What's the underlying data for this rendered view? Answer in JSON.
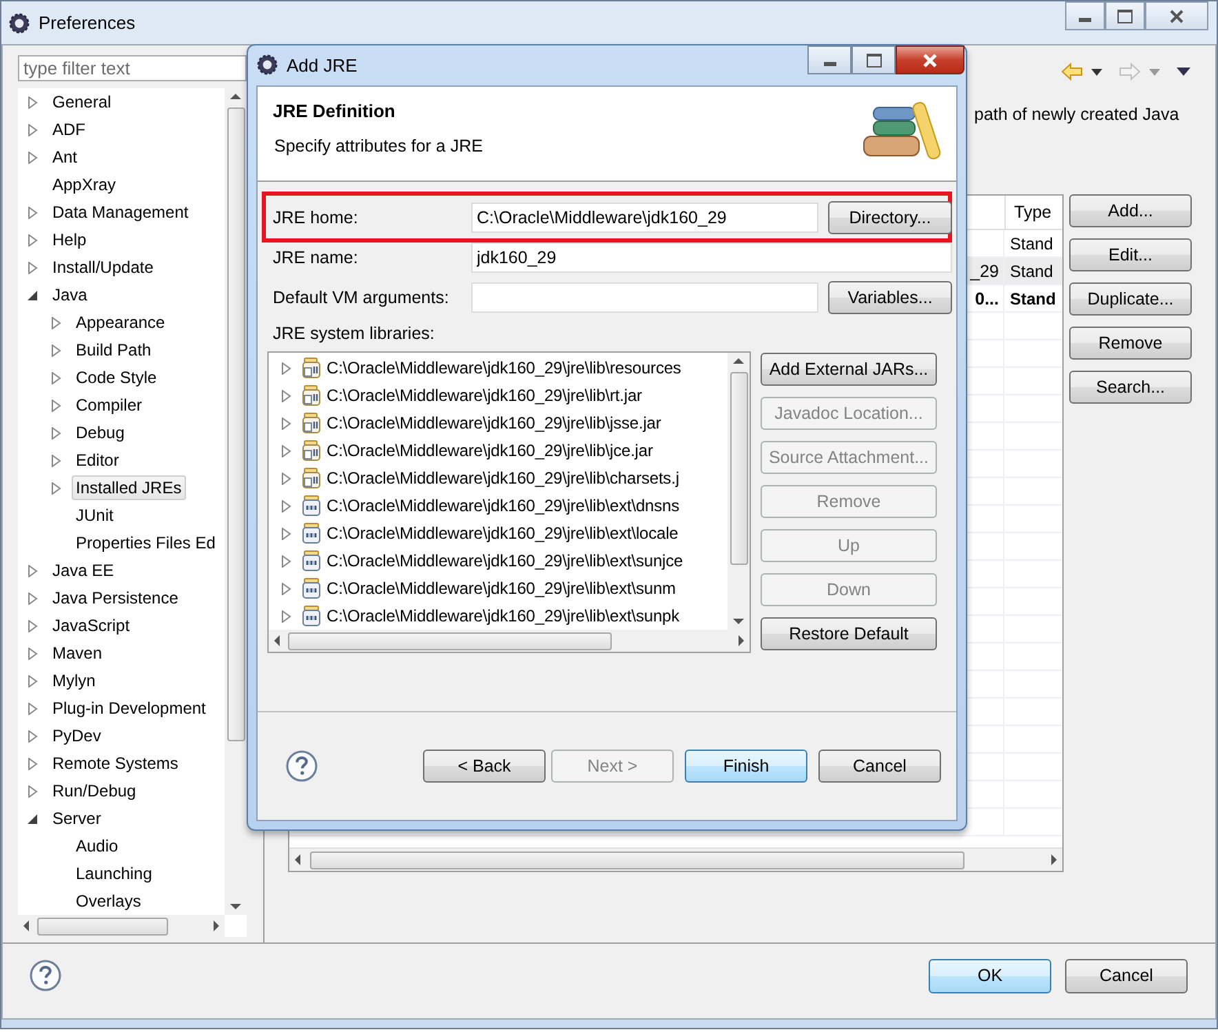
{
  "window": {
    "title": "Preferences"
  },
  "filter": {
    "placeholder": "type filter text"
  },
  "tree": [
    {
      "label": "General",
      "kind": "folder",
      "expanded": false,
      "selected": false
    },
    {
      "label": "ADF",
      "kind": "folder",
      "expanded": false,
      "selected": false
    },
    {
      "label": "Ant",
      "kind": "folder",
      "expanded": false,
      "selected": false
    },
    {
      "label": "AppXray",
      "kind": "leaf",
      "selected": false
    },
    {
      "label": "Data Management",
      "kind": "folder",
      "expanded": false,
      "selected": false
    },
    {
      "label": "Help",
      "kind": "folder",
      "expanded": false,
      "selected": false
    },
    {
      "label": "Install/Update",
      "kind": "folder",
      "expanded": false,
      "selected": false
    },
    {
      "label": "Java",
      "kind": "folder",
      "expanded": true,
      "selected": false,
      "children": [
        {
          "label": "Appearance",
          "kind": "folder",
          "expanded": false,
          "selected": false
        },
        {
          "label": "Build Path",
          "kind": "folder",
          "expanded": false,
          "selected": false
        },
        {
          "label": "Code Style",
          "kind": "folder",
          "expanded": false,
          "selected": false
        },
        {
          "label": "Compiler",
          "kind": "folder",
          "expanded": false,
          "selected": false
        },
        {
          "label": "Debug",
          "kind": "folder",
          "expanded": false,
          "selected": false
        },
        {
          "label": "Editor",
          "kind": "folder",
          "expanded": false,
          "selected": false
        },
        {
          "label": "Installed JREs",
          "kind": "folder",
          "expanded": false,
          "selected": true
        },
        {
          "label": "JUnit",
          "kind": "leaf",
          "selected": false
        },
        {
          "label": "Properties Files Ed",
          "kind": "leaf",
          "selected": false
        }
      ]
    },
    {
      "label": "Java EE",
      "kind": "folder",
      "expanded": false,
      "selected": false
    },
    {
      "label": "Java Persistence",
      "kind": "folder",
      "expanded": false,
      "selected": false
    },
    {
      "label": "JavaScript",
      "kind": "folder",
      "expanded": false,
      "selected": false
    },
    {
      "label": "Maven",
      "kind": "folder",
      "expanded": false,
      "selected": false
    },
    {
      "label": "Mylyn",
      "kind": "folder",
      "expanded": false,
      "selected": false
    },
    {
      "label": "Plug-in Development",
      "kind": "folder",
      "expanded": false,
      "selected": false
    },
    {
      "label": "PyDev",
      "kind": "folder",
      "expanded": false,
      "selected": false
    },
    {
      "label": "Remote Systems",
      "kind": "folder",
      "expanded": false,
      "selected": false
    },
    {
      "label": "Run/Debug",
      "kind": "folder",
      "expanded": false,
      "selected": false
    },
    {
      "label": "Server",
      "kind": "folder",
      "expanded": true,
      "selected": false,
      "children": [
        {
          "label": "Audio",
          "kind": "leaf",
          "selected": false
        },
        {
          "label": "Launching",
          "kind": "leaf",
          "selected": false
        },
        {
          "label": "Overlays",
          "kind": "leaf",
          "selected": false
        }
      ]
    }
  ],
  "page": {
    "description": "path of newly created Java",
    "table": {
      "columns": [
        "Type"
      ],
      "rows": [
        {
          "type": "Stand",
          "selected": false,
          "default": false
        },
        {
          "name": "_29",
          "type": "Stand",
          "selected": true,
          "default": false
        },
        {
          "name": "0...",
          "type": "Stand",
          "selected": false,
          "default": true
        }
      ]
    },
    "buttons": [
      "Add...",
      "Edit...",
      "Duplicate...",
      "Remove",
      "Search..."
    ]
  },
  "footer": {
    "buttons": [
      {
        "label": "OK",
        "default": true
      },
      {
        "label": "Cancel",
        "default": false
      }
    ]
  },
  "dialog": {
    "title": "Add JRE",
    "header": {
      "title": "JRE Definition",
      "subtitle": "Specify attributes for a JRE"
    },
    "fields": [
      {
        "label": "JRE home:",
        "value": "C:\\Oracle\\Middleware\\jdk160_29",
        "button": "Directory...",
        "highlighted": true
      },
      {
        "label": "JRE name:",
        "value": "jdk160_29",
        "highlighted": false
      },
      {
        "label": "Default VM arguments:",
        "button": "Variables...",
        "highlighted": false
      }
    ],
    "libraries": {
      "label": "JRE system libraries:",
      "items": [
        {
          "path": "C:\\Oracle\\Middleware\\jdk160_29\\jre\\lib\\resources",
          "kind": "jar",
          "expanded": false
        },
        {
          "path": "C:\\Oracle\\Middleware\\jdk160_29\\jre\\lib\\rt.jar",
          "kind": "jar",
          "expanded": false
        },
        {
          "path": "C:\\Oracle\\Middleware\\jdk160_29\\jre\\lib\\jsse.jar",
          "kind": "jar",
          "expanded": false
        },
        {
          "path": "C:\\Oracle\\Middleware\\jdk160_29\\jre\\lib\\jce.jar",
          "kind": "jar",
          "expanded": false
        },
        {
          "path": "C:\\Oracle\\Middleware\\jdk160_29\\jre\\lib\\charsets.j",
          "kind": "jar",
          "expanded": false
        },
        {
          "path": "C:\\Oracle\\Middleware\\jdk160_29\\jre\\lib\\ext\\dnsns",
          "kind": "binary",
          "expanded": false
        },
        {
          "path": "C:\\Oracle\\Middleware\\jdk160_29\\jre\\lib\\ext\\locale",
          "kind": "binary",
          "expanded": false
        },
        {
          "path": "C:\\Oracle\\Middleware\\jdk160_29\\jre\\lib\\ext\\sunjce",
          "kind": "binary",
          "expanded": false
        },
        {
          "path": "C:\\Oracle\\Middleware\\jdk160_29\\jre\\lib\\ext\\sunm",
          "kind": "binary",
          "expanded": false
        },
        {
          "path": "C:\\Oracle\\Middleware\\jdk160_29\\jre\\lib\\ext\\sunpk",
          "kind": "binary",
          "expanded": false
        }
      ],
      "buttons": [
        {
          "label": "Add External JARs...",
          "disabled": false
        },
        {
          "label": "Javadoc Location...",
          "disabled": true
        },
        {
          "label": "Source Attachment...",
          "disabled": true
        },
        {
          "label": "Remove",
          "disabled": true
        },
        {
          "label": "Up",
          "disabled": true
        },
        {
          "label": "Down",
          "disabled": true
        },
        {
          "label": "Restore Default",
          "disabled": false
        }
      ]
    },
    "buttons": [
      {
        "label": "< Back",
        "disabled": false,
        "default": false
      },
      {
        "label": "Next >",
        "disabled": true,
        "default": false
      },
      {
        "label": "Finish",
        "disabled": false,
        "default": true
      },
      {
        "label": "Cancel",
        "disabled": false,
        "default": false
      }
    ]
  }
}
